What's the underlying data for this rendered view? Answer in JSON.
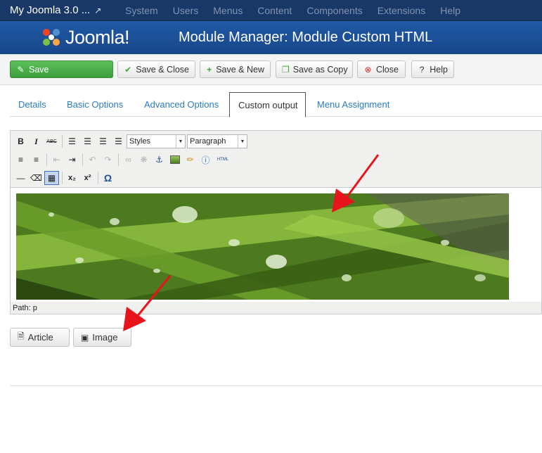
{
  "topbar": {
    "site_title": "My Joomla 3.0 ...",
    "menu": [
      "System",
      "Users",
      "Menus",
      "Content",
      "Components",
      "Extensions",
      "Help"
    ]
  },
  "header": {
    "logo_text": "Joomla!",
    "page_title": "Module Manager: Module Custom HTML"
  },
  "toolbar": {
    "save": "Save",
    "save_close": "Save & Close",
    "save_new": "Save & New",
    "save_copy": "Save as Copy",
    "close": "Close",
    "help": "Help"
  },
  "tabs": {
    "details": "Details",
    "basic": "Basic Options",
    "advanced": "Advanced Options",
    "custom": "Custom output",
    "menu": "Menu Assignment",
    "active": "Custom output"
  },
  "editor": {
    "bold": "B",
    "italic": "I",
    "strike": "ABC",
    "styles": "Styles",
    "format": "Paragraph",
    "html_label": "HTML",
    "subscript": "x₂",
    "superscript": "x²",
    "omega": "Ω",
    "path": "Path: p"
  },
  "buttons": {
    "article": "Article",
    "image": "Image"
  },
  "colors": {
    "navbar": "#1a3867",
    "header": "#1d4f96",
    "save_green": "#46a546",
    "link": "#2a7cc0",
    "arrow": "#e8141b"
  }
}
